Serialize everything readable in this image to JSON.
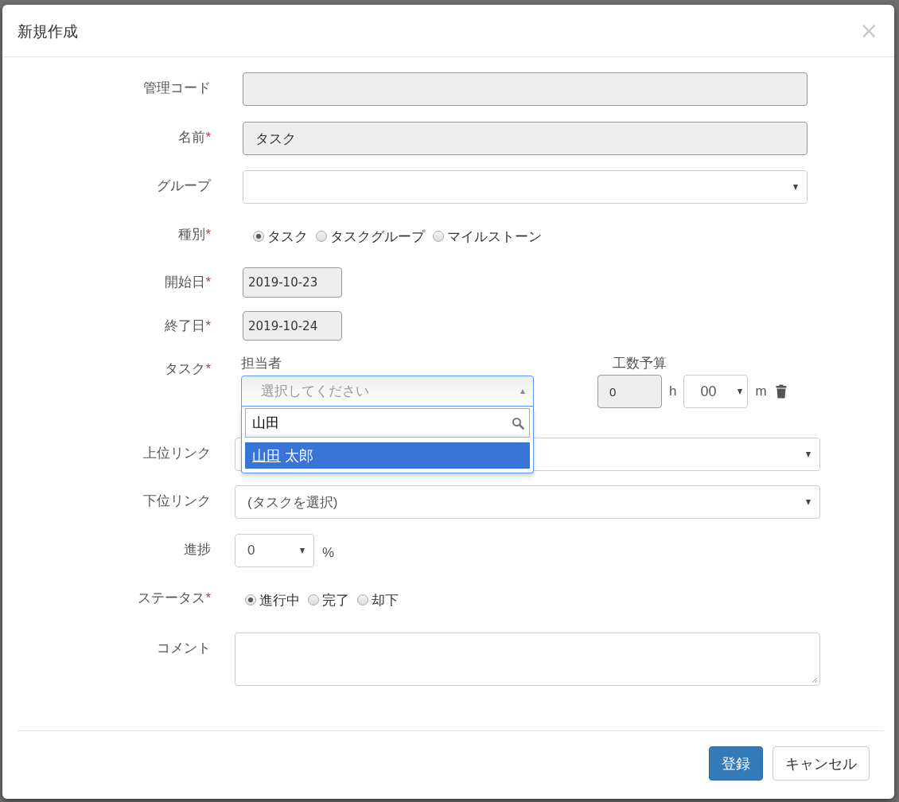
{
  "dialog": {
    "title": "新規作成",
    "close": "×"
  },
  "fields": [
    {
      "kind": "text",
      "label": "管理コード"
    },
    {
      "kind": "text",
      "label": "名前",
      "mark": "*",
      "value": "タスク"
    },
    {
      "kind": "select",
      "label": "グループ"
    },
    {
      "kind": "radio",
      "label": "種別",
      "mark": "*",
      "options": [
        {
          "label": "タスク",
          "selected": true
        },
        {
          "label": "タスクグループ",
          "selected": false
        },
        {
          "label": "マイルストーン",
          "selected": false
        }
      ]
    },
    {
      "kind": "date",
      "label": "開始日",
      "mark": "*",
      "value": "2019-10-23"
    },
    {
      "kind": "date",
      "label": "終了日",
      "mark": "*",
      "value": "2019-10-24"
    },
    {
      "kind": "task",
      "label": "タスク",
      "mark": "*",
      "assignee": {
        "label": "担当者",
        "placeholder": "選択してください",
        "expanded": true,
        "search": "山田",
        "results": [
          {
            "match": "山田",
            "rest": "太郎",
            "selected": true
          }
        ]
      },
      "budget": {
        "label": "工数予算",
        "hours": "0",
        "hours_unit": "h",
        "minutes": "00",
        "minutes_unit": "m"
      }
    },
    {
      "kind": "select",
      "label": "上位リンク"
    },
    {
      "kind": "select",
      "label": "下位リンク",
      "value": "(タスクを選択)"
    },
    {
      "kind": "progress",
      "label": "進捗",
      "value": "0",
      "unit": "%"
    },
    {
      "kind": "radio",
      "label": "ステータス",
      "mark": "*",
      "options": [
        {
          "label": "進行中",
          "selected": true
        },
        {
          "label": "完了",
          "selected": false
        },
        {
          "label": "却下",
          "selected": false
        }
      ]
    },
    {
      "kind": "textarea",
      "label": "コメント"
    }
  ],
  "buttons": [
    {
      "label": "登録",
      "kind": "primary"
    },
    {
      "label": "キャンセル",
      "kind": "default"
    }
  ]
}
